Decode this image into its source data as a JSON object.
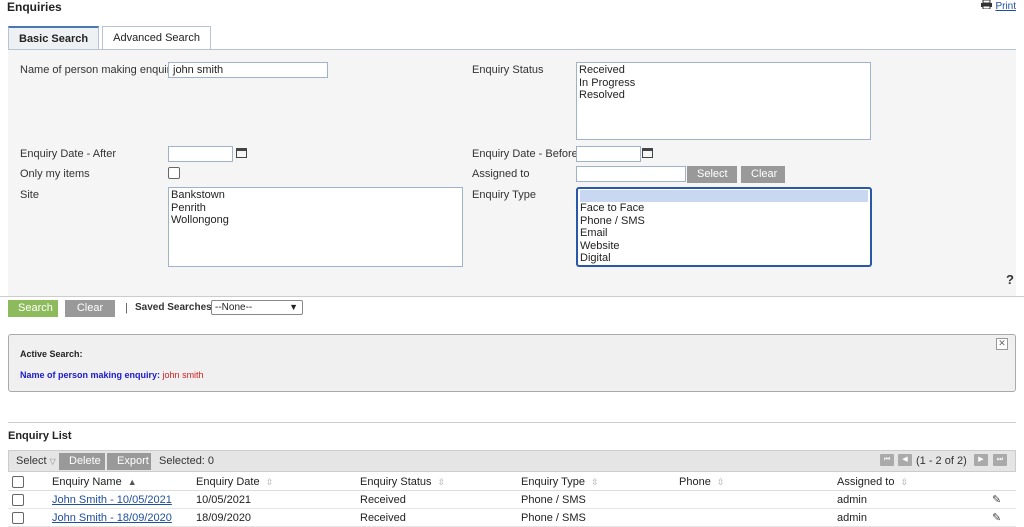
{
  "page": {
    "title": "Enquiries",
    "print_label": "Print"
  },
  "tabs": [
    {
      "label": "Basic Search",
      "active": true
    },
    {
      "label": "Advanced Search",
      "active": false
    }
  ],
  "form": {
    "name_label": "Name of person making enquiry",
    "name_value": "john smith",
    "status_label": "Enquiry Status",
    "status_options": [
      "Received",
      "In Progress",
      "Resolved"
    ],
    "date_after_label": "Enquiry Date - After",
    "date_after_value": "",
    "date_before_label": "Enquiry Date - Before",
    "date_before_value": "",
    "only_my_label": "Only my items",
    "assigned_label": "Assigned to",
    "assigned_value": "",
    "select_button": "Select",
    "clear_button": "Clear",
    "site_label": "Site",
    "site_options": [
      "Bankstown",
      "Penrith",
      "Wollongong"
    ],
    "type_label": "Enquiry Type",
    "type_options": [
      "",
      "Face to Face",
      "Phone / SMS",
      "Email",
      "Website",
      "Digital"
    ],
    "help": "?"
  },
  "actions": {
    "search_button": "Search",
    "clear_button": "Clear",
    "divider": "|",
    "saved_searches_label": "Saved Searches",
    "saved_searches_value": "--None--"
  },
  "active_search": {
    "heading": "Active Search:",
    "criteria_label": "Name of person making enquiry:",
    "criteria_value": "john smith"
  },
  "list": {
    "title": "Enquiry List",
    "select_label": "Select",
    "delete_button": "Delete",
    "export_button": "Export",
    "selected_text": "Selected: 0",
    "pagination": "(1 - 2 of 2)",
    "columns": [
      "Enquiry Name",
      "Enquiry Date",
      "Enquiry Status",
      "Enquiry Type",
      "Phone",
      "Assigned to"
    ],
    "rows": [
      {
        "name": "John Smith - 10/05/2021",
        "date": "10/05/2021",
        "status": "Received",
        "type": "Phone / SMS",
        "phone": "",
        "assigned": "admin"
      },
      {
        "name": "John Smith - 18/09/2020",
        "date": "18/09/2020",
        "status": "Received",
        "type": "Phone / SMS",
        "phone": "",
        "assigned": "admin"
      }
    ]
  },
  "colors": {
    "accent": "#8dbb5c",
    "link": "#1f4fa0",
    "focus": "#2a58a8",
    "criteria_label": "#1a1ad0",
    "criteria_value": "#d02020"
  }
}
